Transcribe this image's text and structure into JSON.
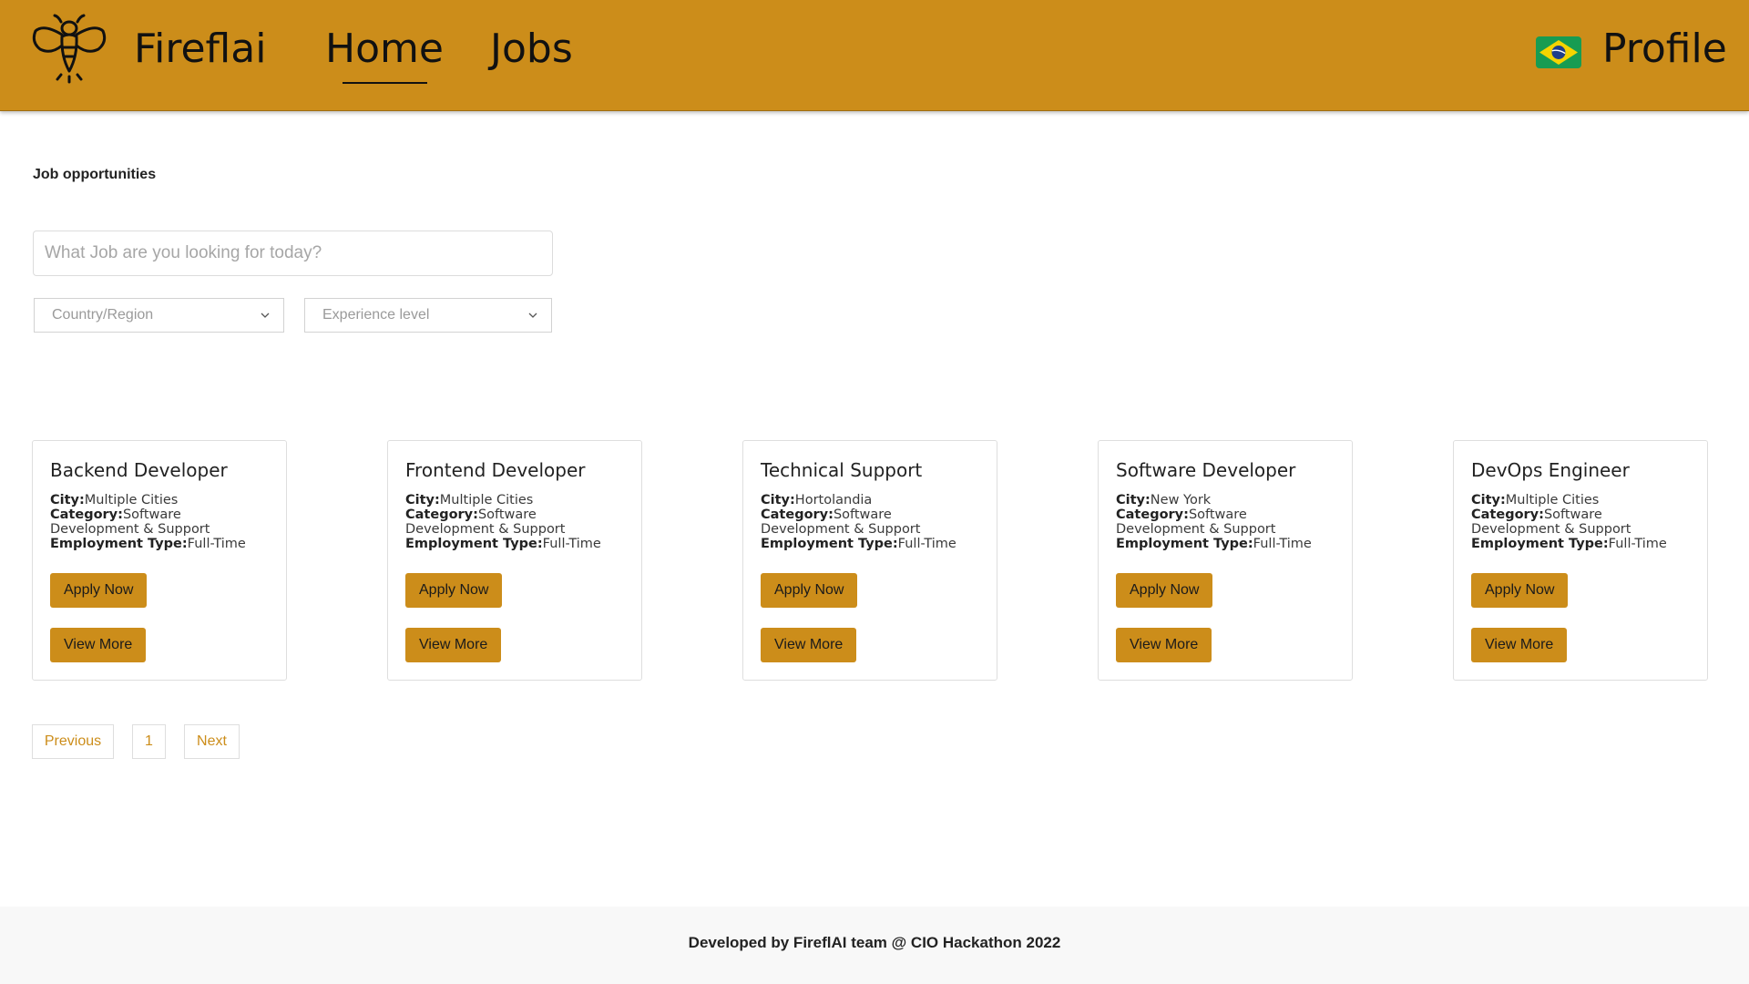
{
  "header": {
    "brand_name": "Fireflai",
    "logo_icon": "firefly-icon",
    "nav": {
      "home": "Home",
      "jobs": "Jobs",
      "active": "Home"
    },
    "language_flag": "brazil-flag-icon",
    "profile": "Profile",
    "bar_color": "#cc8d1a"
  },
  "main": {
    "section_title": "Job opportunities",
    "search": {
      "placeholder": "What Job are you looking for today?",
      "value": ""
    },
    "filters": {
      "country": "Country/Region",
      "experience": "Experience level",
      "chevron_icon": "chevron-down-icon"
    },
    "labels": {
      "city": "City:",
      "category": "Category:",
      "employment_type": "Employment Type:",
      "apply": "Apply Now",
      "view_more": "View More"
    },
    "jobs": [
      {
        "title": "Backend Developer",
        "city": "Multiple Cities",
        "category": "Software Development & Support",
        "employment_type": "Full-Time"
      },
      {
        "title": "Frontend Developer",
        "city": "Multiple Cities",
        "category": "Software Development & Support",
        "employment_type": "Full-Time"
      },
      {
        "title": "Technical Support",
        "city": "Hortolandia",
        "category": "Software Development & Support",
        "employment_type": "Full-Time"
      },
      {
        "title": "Software Developer",
        "city": "New York",
        "category": "Software Development & Support",
        "employment_type": "Full-Time"
      },
      {
        "title": "DevOps Engineer",
        "city": "Multiple Cities",
        "category": "Software Development & Support",
        "employment_type": "Full-Time"
      }
    ],
    "pagination": {
      "previous": "Previous",
      "current_page": "1",
      "next": "Next"
    }
  },
  "footer": {
    "text": "Developed by FireflAI team @ CIO Hackathon 2022"
  }
}
